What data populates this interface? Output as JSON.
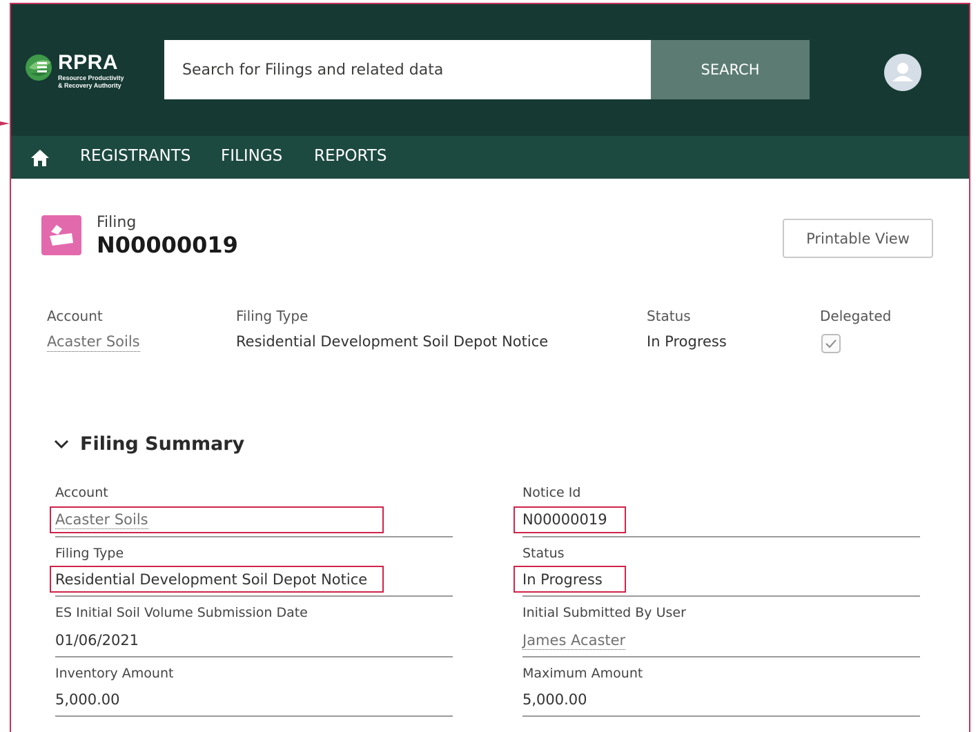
{
  "brand": {
    "name": "RPRA",
    "subtitle_line1": "Resource Productivity",
    "subtitle_line2": "& Recovery Authority"
  },
  "search": {
    "placeholder": "Search for Filings and related data",
    "button_label": "SEARCH"
  },
  "nav": {
    "items": [
      {
        "label": "REGISTRANTS"
      },
      {
        "label": "FILINGS"
      },
      {
        "label": "REPORTS"
      }
    ]
  },
  "record": {
    "object_label": "Filing",
    "title": "N00000019",
    "printable_label": "Printable View"
  },
  "highlights": {
    "account_label": "Account",
    "account_value": "Acaster Soils",
    "filing_type_label": "Filing Type",
    "filing_type_value": "Residential Development Soil Depot Notice",
    "status_label": "Status",
    "status_value": "In Progress",
    "delegated_label": "Delegated",
    "delegated_checked": true
  },
  "section": {
    "title": "Filing Summary",
    "fields": {
      "account_label": "Account",
      "account_value": "Acaster Soils",
      "notice_label": "Notice Id",
      "notice_value": "N00000019",
      "filing_type_label": "Filing Type",
      "filing_type_value": "Residential Development Soil Depot Notice",
      "status_label": "Status",
      "status_value": "In Progress",
      "es_date_label": "ES Initial Soil Volume Submission Date",
      "es_date_value": "01/06/2021",
      "submitted_by_label": "Initial Submitted By User",
      "submitted_by_value": "James Acaster",
      "inventory_label": "Inventory Amount",
      "inventory_value": "5,000.00",
      "maximum_label": "Maximum Amount",
      "maximum_value": "5,000.00"
    }
  },
  "colors": {
    "header_bg": "#163a33",
    "nav_bg": "#1d4a40",
    "search_button": "#5c7c73",
    "record_icon": "#e369ad",
    "highlight_box": "#d0234a",
    "frame_border": "#c8325c"
  }
}
